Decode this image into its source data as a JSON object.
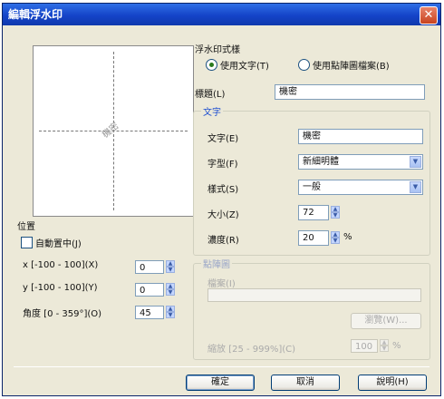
{
  "window": {
    "title": "編輯浮水印",
    "close_glyph": "✕"
  },
  "preview": {
    "watermark_text": "機密"
  },
  "position": {
    "heading": "位置",
    "auto_center": "自動置中(J)",
    "x_label": "x [-100 - 100](X)",
    "x_value": "0",
    "y_label": "y [-100 - 100](Y)",
    "y_value": "0",
    "angle_label": "角度 [0 - 359°](O)",
    "angle_value": "45"
  },
  "style": {
    "heading": "浮水印式樣",
    "use_text": "使用文字(T)",
    "use_bitmap": "使用點陣圖檔案(B)"
  },
  "title": {
    "label": "標題(L)",
    "value": "機密"
  },
  "text_group": {
    "legend": "文字",
    "text_label": "文字(E)",
    "text_value": "機密",
    "font_label": "字型(F)",
    "font_value": "新細明體",
    "style_label": "樣式(S)",
    "style_value": "一般",
    "size_label": "大小(Z)",
    "size_value": "72",
    "darkness_label": "濃度(R)",
    "darkness_value": "20",
    "darkness_unit": "%"
  },
  "bitmap_group": {
    "legend": "點陣圖",
    "file_label": "檔案(I)",
    "browse_button": "瀏覽(W)...",
    "scale_label": "縮放 [25 - 999%](C)",
    "scale_value": "100",
    "scale_unit": "%"
  },
  "buttons": {
    "ok": "確定",
    "cancel": "取消",
    "help": "說明(H)"
  },
  "icons": {
    "spin_up": "▲",
    "spin_down": "▼",
    "dropdown": "▼"
  }
}
